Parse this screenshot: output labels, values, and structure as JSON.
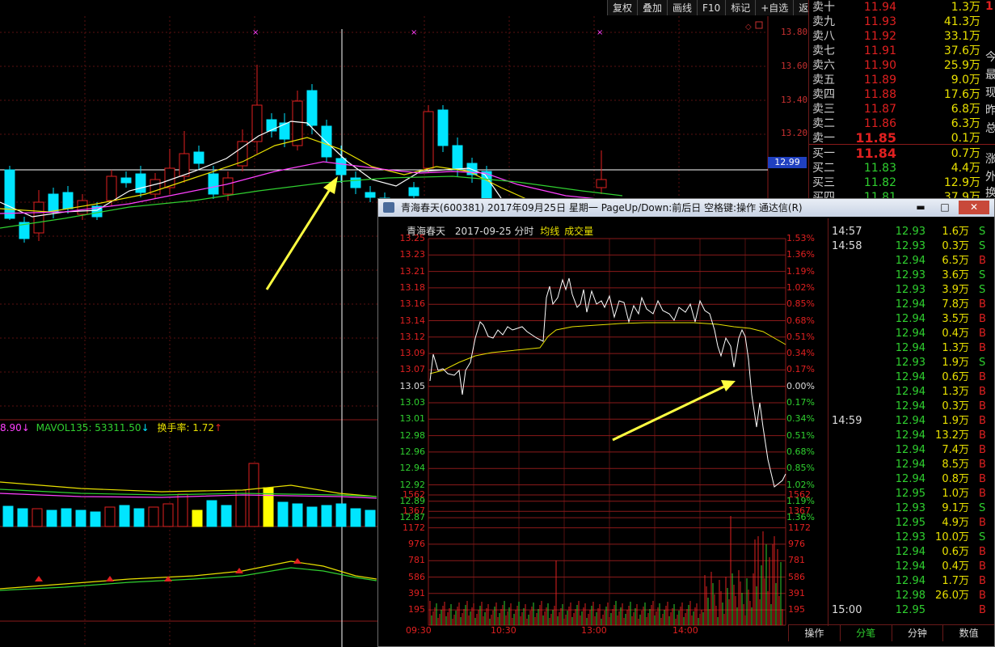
{
  "toolbar": {
    "buttons": [
      "复权",
      "叠加",
      "画线",
      "F10",
      "标记",
      "+自选",
      "返回"
    ]
  },
  "main": {
    "price_axis": [
      "13.80",
      "13.60",
      "13.40",
      "13.20"
    ],
    "current_price_tag": "12.99",
    "indicator_line_prefix": "8.90",
    "indicator_line": "MAVOL135: 53311.50",
    "turnover_label": "换手率: 1.72",
    "colors": {
      "up": "#e02020",
      "down": "#00e5ff",
      "ma5": "#ffffff",
      "ma10": "#e8e000",
      "ma20": "#ff40ff",
      "ma60": "#30d030"
    }
  },
  "orderbook": {
    "asks": [
      {
        "label": "卖十",
        "price": "11.94",
        "vol": "1.3万"
      },
      {
        "label": "卖九",
        "price": "11.93",
        "vol": "41.3万"
      },
      {
        "label": "卖八",
        "price": "11.92",
        "vol": "33.1万"
      },
      {
        "label": "卖七",
        "price": "11.91",
        "vol": "37.6万"
      },
      {
        "label": "卖六",
        "price": "11.90",
        "vol": "25.9万"
      },
      {
        "label": "卖五",
        "price": "11.89",
        "vol": "9.0万"
      },
      {
        "label": "卖四",
        "price": "11.88",
        "vol": "17.6万"
      },
      {
        "label": "卖三",
        "price": "11.87",
        "vol": "6.8万"
      },
      {
        "label": "卖二",
        "price": "11.86",
        "vol": "6.3万"
      },
      {
        "label": "卖一",
        "price": "11.85",
        "vol": "0.1万"
      }
    ],
    "bids": [
      {
        "label": "买一",
        "price": "11.84",
        "vol": "0.7万"
      },
      {
        "label": "买二",
        "price": "11.83",
        "vol": "4.4万"
      },
      {
        "label": "买三",
        "price": "11.82",
        "vol": "12.9万"
      },
      {
        "label": "买四",
        "price": "11.81",
        "vol": "37.9万"
      }
    ],
    "side_chars": [
      "1",
      "今",
      "最",
      "现",
      "昨",
      "总",
      "涨",
      "外",
      "换"
    ]
  },
  "popup": {
    "title": "青海春天(600381) 2017年09月25日 星期一 PageUp/Down:前后日 空格键:操作 通达信(R)",
    "chart_header": {
      "name": "青海春天",
      "date": "2017-09-25 分时",
      "avg_label": "均线",
      "vol_label": "成交量"
    },
    "left_axis": [
      "13.25",
      "13.23",
      "13.21",
      "13.18",
      "13.16",
      "13.14",
      "13.12",
      "13.09",
      "13.07",
      "13.05",
      "13.03",
      "13.01",
      "12.98",
      "12.96",
      "12.94",
      "12.92",
      "12.89",
      "12.87"
    ],
    "right_axis": [
      "1.53%",
      "1.36%",
      "1.19%",
      "1.02%",
      "0.85%",
      "0.68%",
      "0.51%",
      "0.34%",
      "0.17%",
      "0.00%",
      "0.17%",
      "0.34%",
      "0.51%",
      "0.68%",
      "0.85%",
      "1.02%",
      "1.19%",
      "1.36%"
    ],
    "vol_axis": [
      "1562",
      "1367",
      "1172",
      "976",
      "781",
      "586",
      "391",
      "195"
    ],
    "time_axis": [
      "09:30",
      "10:30",
      "13:00",
      "14:00"
    ],
    "ticks": [
      {
        "time": "14:57",
        "price": "12.93",
        "vol": "1.6万",
        "side": "S"
      },
      {
        "time": "14:58",
        "price": "12.93",
        "vol": "0.3万",
        "side": "S"
      },
      {
        "time": "",
        "price": "12.94",
        "vol": "6.5万",
        "side": "B"
      },
      {
        "time": "",
        "price": "12.93",
        "vol": "3.6万",
        "side": "S"
      },
      {
        "time": "",
        "price": "12.93",
        "vol": "3.9万",
        "side": "S"
      },
      {
        "time": "",
        "price": "12.94",
        "vol": "7.8万",
        "side": "B"
      },
      {
        "time": "",
        "price": "12.94",
        "vol": "3.5万",
        "side": "B"
      },
      {
        "time": "",
        "price": "12.94",
        "vol": "0.4万",
        "side": "B"
      },
      {
        "time": "",
        "price": "12.94",
        "vol": "1.3万",
        "side": "B"
      },
      {
        "time": "",
        "price": "12.93",
        "vol": "1.9万",
        "side": "S"
      },
      {
        "time": "",
        "price": "12.94",
        "vol": "0.6万",
        "side": "B"
      },
      {
        "time": "",
        "price": "12.94",
        "vol": "1.3万",
        "side": "B"
      },
      {
        "time": "",
        "price": "12.94",
        "vol": "0.3万",
        "side": "B"
      },
      {
        "time": "14:59",
        "price": "12.94",
        "vol": "1.9万",
        "side": "B"
      },
      {
        "time": "",
        "price": "12.94",
        "vol": "13.2万",
        "side": "B"
      },
      {
        "time": "",
        "price": "12.94",
        "vol": "7.4万",
        "side": "B"
      },
      {
        "time": "",
        "price": "12.94",
        "vol": "8.5万",
        "side": "B"
      },
      {
        "time": "",
        "price": "12.94",
        "vol": "0.8万",
        "side": "B"
      },
      {
        "time": "",
        "price": "12.95",
        "vol": "1.0万",
        "side": "B"
      },
      {
        "time": "",
        "price": "12.93",
        "vol": "9.1万",
        "side": "S"
      },
      {
        "time": "",
        "price": "12.95",
        "vol": "4.9万",
        "side": "B"
      },
      {
        "time": "",
        "price": "12.93",
        "vol": "10.0万",
        "side": "S"
      },
      {
        "time": "",
        "price": "12.94",
        "vol": "0.6万",
        "side": "B"
      },
      {
        "time": "",
        "price": "12.94",
        "vol": "0.4万",
        "side": "B"
      },
      {
        "time": "",
        "price": "12.94",
        "vol": "1.7万",
        "side": "B"
      },
      {
        "time": "",
        "price": "12.98",
        "vol": "26.0万",
        "side": "B"
      },
      {
        "time": "15:00",
        "price": "12.95",
        "vol": "",
        "side": "B"
      }
    ],
    "tabs": [
      "操作",
      "分笔",
      "分钟",
      "数值"
    ]
  }
}
